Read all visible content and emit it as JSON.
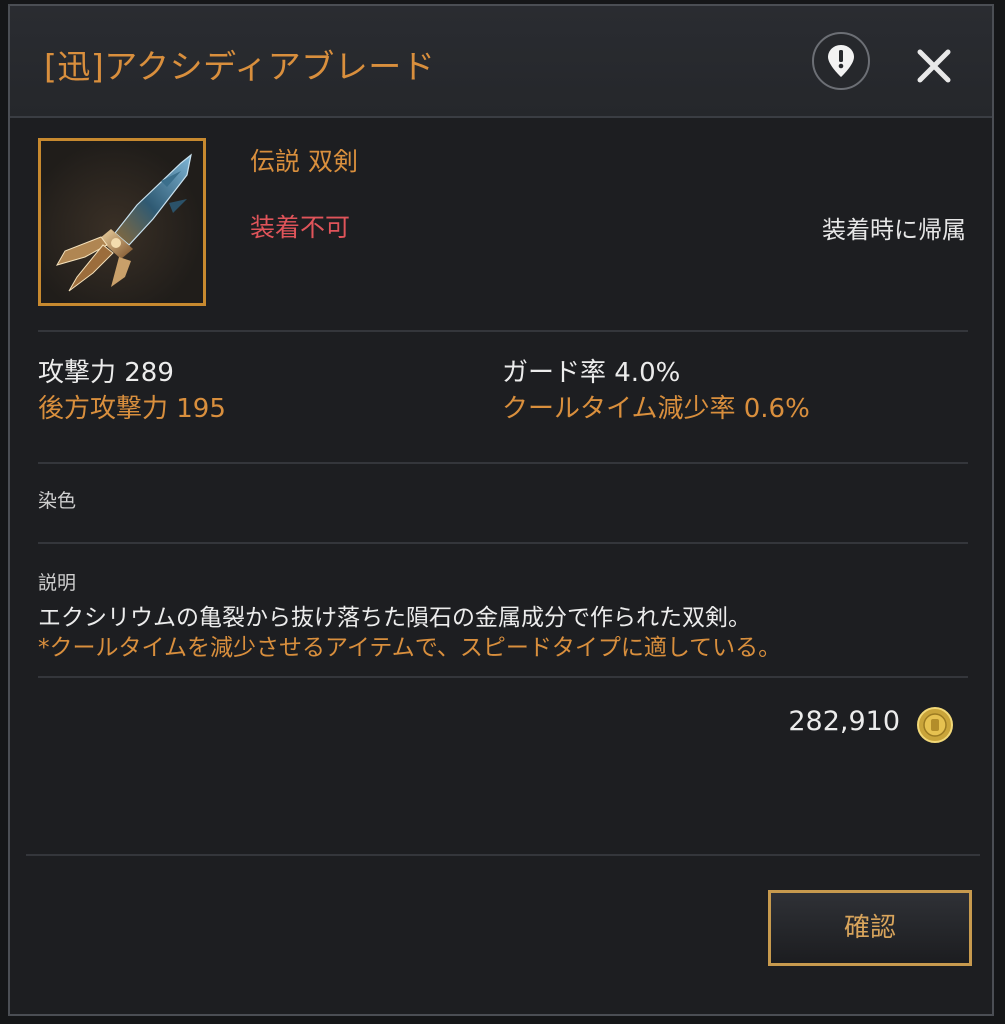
{
  "header": {
    "title": "[迅]アクシディアブレード",
    "info_icon": "location-pin-alert-icon",
    "close_icon": "close-icon"
  },
  "item": {
    "icon": "dual-blade-weapon-icon",
    "rarity_type": "伝説  双剣",
    "equip_status": "装着不可",
    "binding": "装着時に帰属"
  },
  "stats": {
    "attack": "攻撃力 289",
    "back_attack": "後方攻撃力 195",
    "guard_rate": "ガード率 4.0%",
    "cooldown_reduction": "クールタイム減少率 0.6%"
  },
  "dye": {
    "label": "染色"
  },
  "description": {
    "label": "説明",
    "line1": "エクシリウムの亀裂から抜け落ちた隕石の金属成分で作られた双剣。",
    "line2": "*クールタイムを減少させるアイテムで、スピードタイプに適している。"
  },
  "price": {
    "value": "282,910",
    "currency_icon": "gold-coin-icon"
  },
  "footer": {
    "confirm_label": "確認"
  },
  "colors": {
    "accent_orange": "#d98f3d",
    "warning_red": "#e0545a",
    "panel_bg": "#1d1e21",
    "frame_gold": "#c7892f"
  }
}
